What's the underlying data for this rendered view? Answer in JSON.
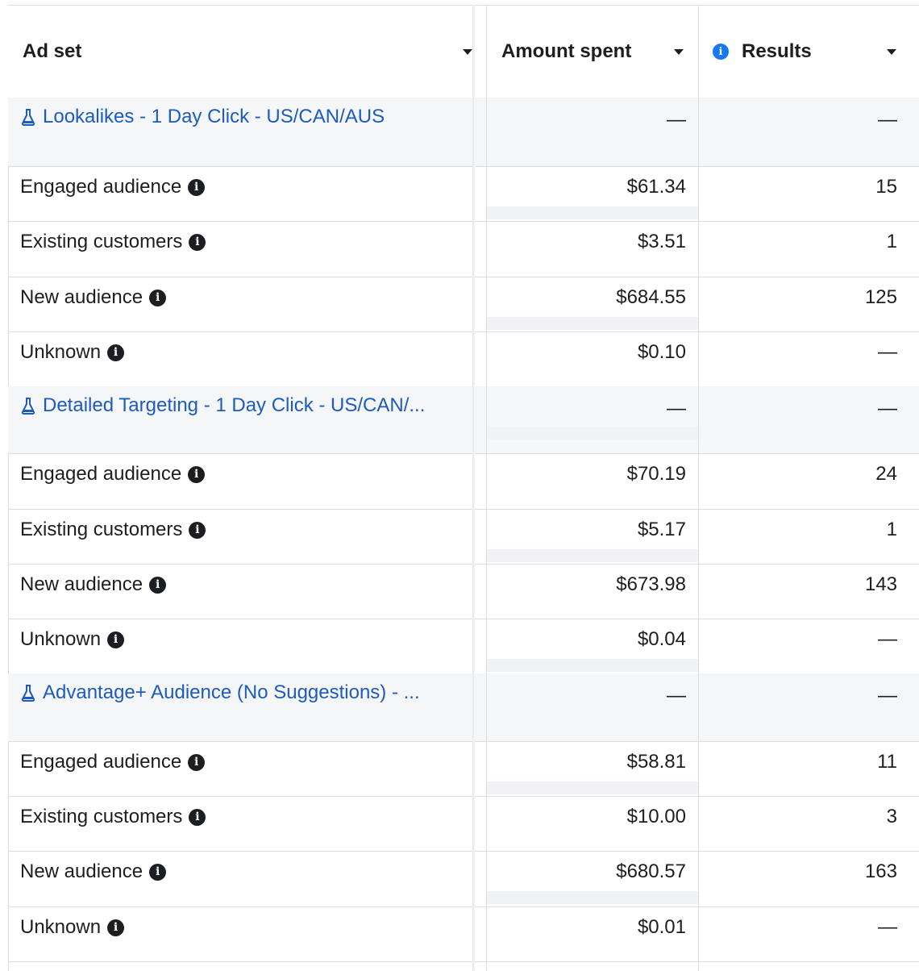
{
  "columns": {
    "ad_set": "Ad set",
    "amount_spent": "Amount spent",
    "results": "Results"
  },
  "info_icon_glyph": "i",
  "rows": [
    {
      "type": "group",
      "name": "Lookalikes - 1 Day Click - US/CAN/AUS",
      "amount": "—",
      "results": "—"
    },
    {
      "type": "sub",
      "name": "Engaged audience",
      "amount": "$61.34",
      "results": "15"
    },
    {
      "type": "sub",
      "name": "Existing customers",
      "amount": "$3.51",
      "results": "1"
    },
    {
      "type": "sub",
      "name": "New audience",
      "amount": "$684.55",
      "results": "125"
    },
    {
      "type": "sub",
      "name": "Unknown",
      "amount": "$0.10",
      "results": "—"
    },
    {
      "type": "group",
      "name": "Detailed Targeting - 1 Day Click - US/CAN/...",
      "amount": "—",
      "results": "—"
    },
    {
      "type": "sub",
      "name": "Engaged audience",
      "amount": "$70.19",
      "results": "24"
    },
    {
      "type": "sub",
      "name": "Existing customers",
      "amount": "$5.17",
      "results": "1"
    },
    {
      "type": "sub",
      "name": "New audience",
      "amount": "$673.98",
      "results": "143"
    },
    {
      "type": "sub",
      "name": "Unknown",
      "amount": "$0.04",
      "results": "—"
    },
    {
      "type": "group",
      "name": "Advantage+ Audience (No Suggestions) - ...",
      "amount": "—",
      "results": "—"
    },
    {
      "type": "sub",
      "name": "Engaged audience",
      "amount": "$58.81",
      "results": "11"
    },
    {
      "type": "sub",
      "name": "Existing customers",
      "amount": "$10.00",
      "results": "3"
    },
    {
      "type": "sub",
      "name": "New audience",
      "amount": "$680.57",
      "results": "163"
    },
    {
      "type": "sub",
      "name": "Unknown",
      "amount": "$0.01",
      "results": "—"
    }
  ]
}
